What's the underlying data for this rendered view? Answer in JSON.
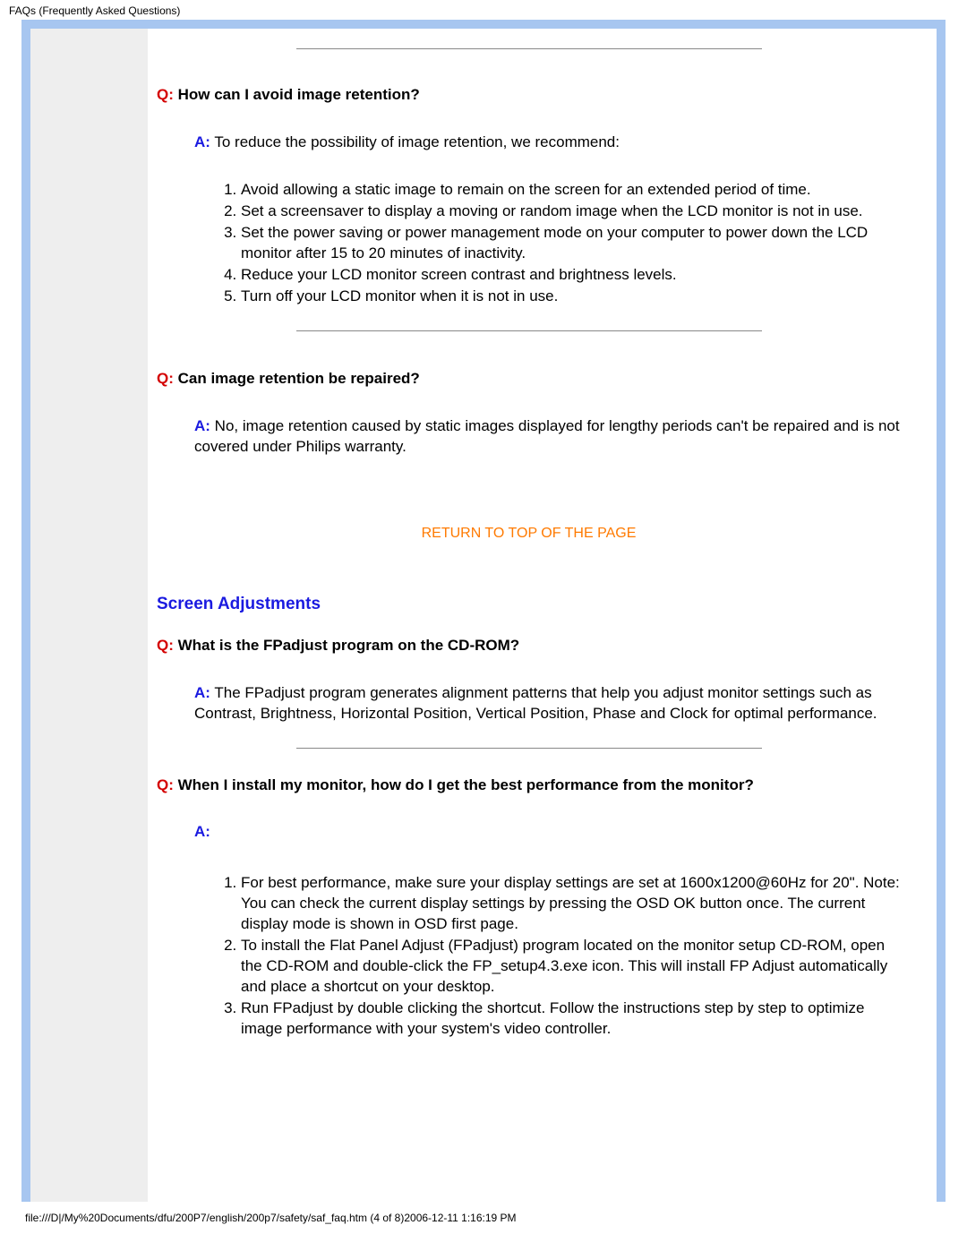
{
  "header": {
    "title": "FAQs (Frequently Asked Questions)"
  },
  "faq1": {
    "q_prefix": "Q:",
    "q_text": " How can I avoid image retention?",
    "a_prefix": "A:",
    "a_text": " To reduce the possibility of image retention, we recommend:",
    "items": [
      "Avoid allowing a static image to remain on the screen for an extended period of time.",
      "Set a screensaver to display a moving or random image when the LCD monitor is not in use.",
      "Set the power saving or power management mode on your computer to power down the LCD monitor after 15 to 20 minutes of inactivity.",
      "Reduce your LCD monitor screen contrast and brightness levels.",
      "Turn off your LCD monitor when it is not in use."
    ]
  },
  "faq2": {
    "q_prefix": "Q:",
    "q_text": " Can image retention be repaired?",
    "a_prefix": "A:",
    "a_text": " No, image retention caused by static images displayed for lengthy periods can't be repaired and is not covered under Philips warranty."
  },
  "return_link": "RETURN TO TOP OF THE PAGE",
  "section": {
    "title": "Screen Adjustments"
  },
  "faq3": {
    "q_prefix": "Q:",
    "q_text": " What is the FPadjust program on the CD-ROM?",
    "a_prefix": "A:",
    "a_text": " The FPadjust program generates alignment patterns that help you adjust monitor settings such as Contrast, Brightness, Horizontal Position, Vertical Position, Phase and Clock for optimal performance."
  },
  "faq4": {
    "q_prefix": "Q:",
    "q_text": " When I install my monitor, how do I get the best performance from the monitor?",
    "a_prefix": "A:",
    "items": [
      "For best performance, make sure your display settings are set at 1600x1200@60Hz for 20\". Note: You can check the current display settings by pressing the OSD OK button once. The current display mode is shown in OSD first page.",
      "To install the Flat Panel Adjust (FPadjust) program located on the monitor setup CD-ROM, open the CD-ROM and double-click the FP_setup4.3.exe icon. This will install FP Adjust automatically and place a shortcut on your desktop.",
      "Run FPadjust by double clicking the shortcut. Follow the instructions step by step to optimize image performance with your system's video controller."
    ]
  },
  "footer": {
    "status": "file:///D|/My%20Documents/dfu/200P7/english/200p7/safety/saf_faq.htm (4 of 8)2006-12-11 1:16:19 PM"
  }
}
